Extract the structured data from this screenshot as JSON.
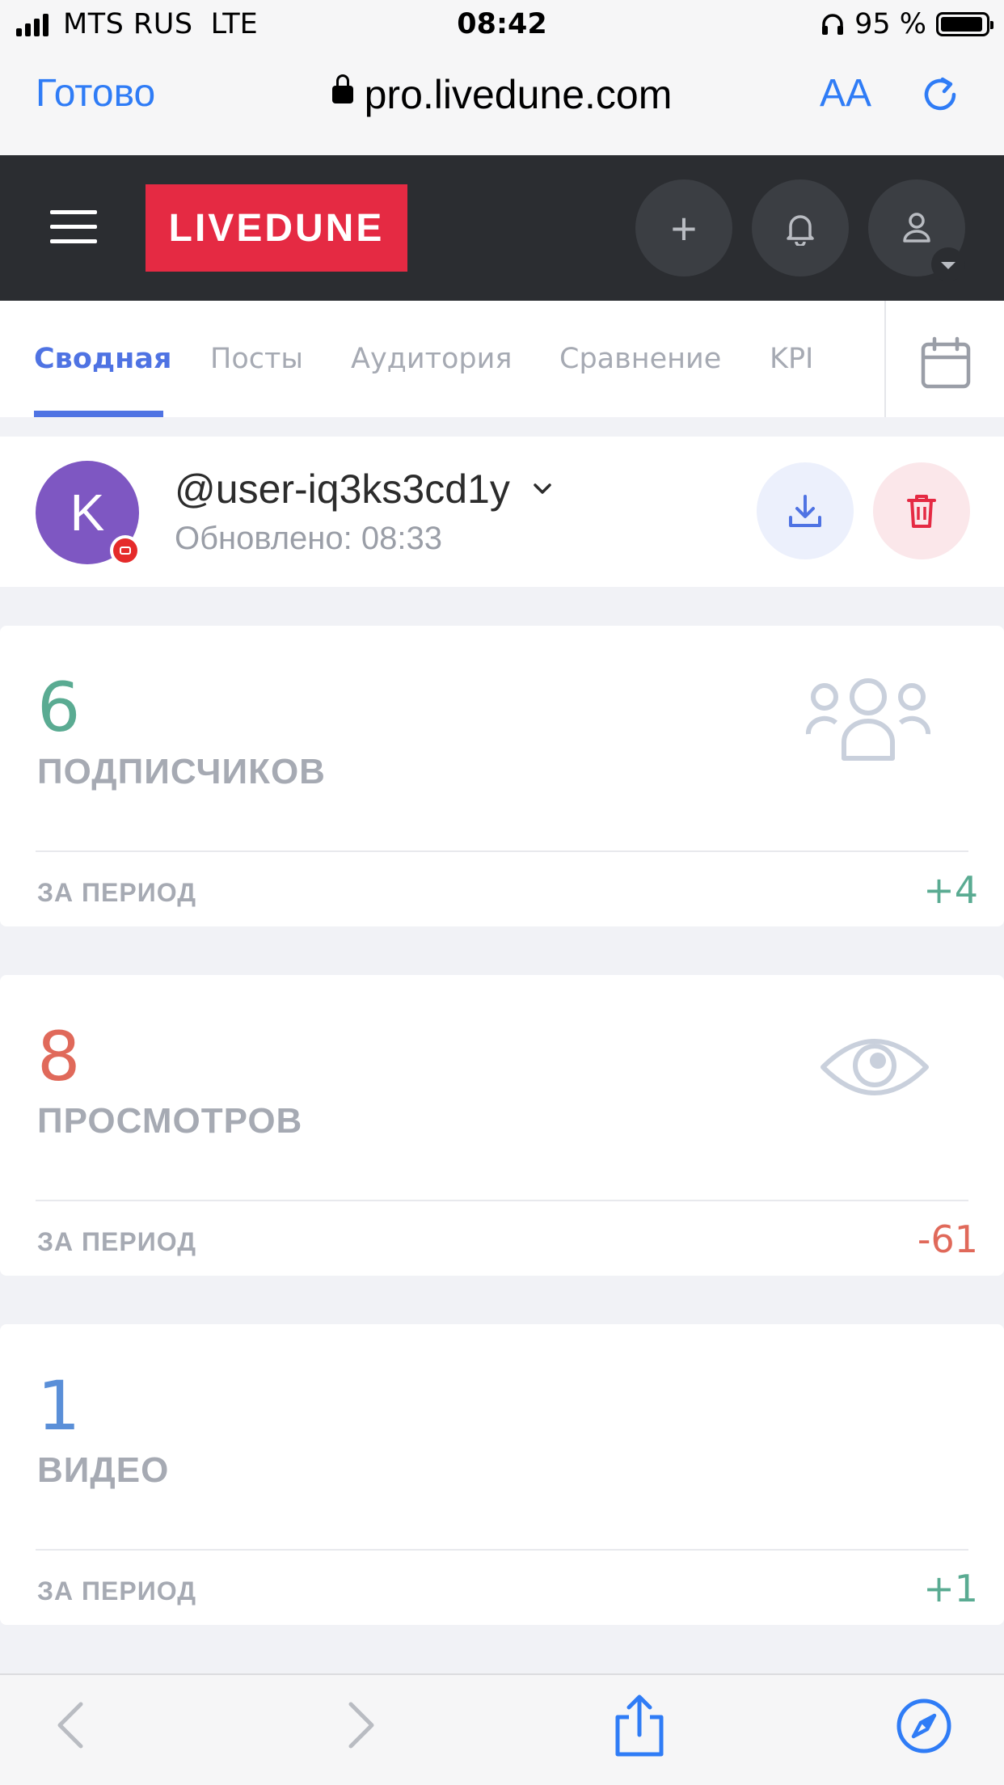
{
  "status_bar": {
    "carrier": "MTS RUS",
    "network": "LTE",
    "time": "08:42",
    "battery": "95 %"
  },
  "browser": {
    "done_label": "Готово",
    "url": "pro.livedune.com",
    "text_size_label": "AA"
  },
  "app": {
    "logo": "LIVEDUNE",
    "add_label": "+"
  },
  "tabs": [
    {
      "label": "Сводная",
      "active": true
    },
    {
      "label": "Посты"
    },
    {
      "label": "Аудитория"
    },
    {
      "label": "Сравнение"
    },
    {
      "label": "KPI"
    }
  ],
  "account": {
    "initial": "K",
    "username": "@user-iq3ks3cd1y",
    "updated": "Обновлено: 08:33"
  },
  "cards": [
    {
      "value": "6",
      "label": "ПОДПИСЧИКОВ",
      "period_label": "ЗА ПЕРИОД",
      "delta": "+4",
      "color": "#5aab92",
      "icon": "users-icon"
    },
    {
      "value": "8",
      "label": "ПРОСМОТРОВ",
      "period_label": "ЗА ПЕРИОД",
      "delta": "-61",
      "color": "#e0695a",
      "icon": "eye-icon"
    },
    {
      "value": "1",
      "label": "ВИДЕО",
      "period_label": "ЗА ПЕРИОД",
      "delta": "+1",
      "color": "#5a8fd8"
    }
  ],
  "colors": {
    "accent": "#4f73e3",
    "brand": "#e52a43",
    "positive": "#5aab92",
    "negative": "#e0695a"
  }
}
